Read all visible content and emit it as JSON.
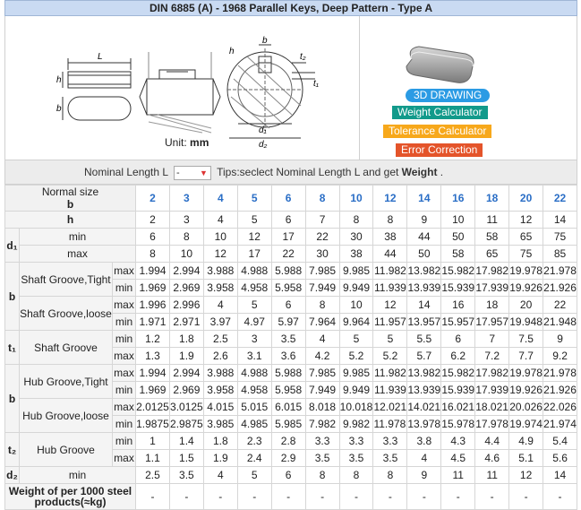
{
  "title": "DIN 6885 (A) - 1968 Parallel Keys, Deep Pattern - Type A",
  "unit_label": "Unit:",
  "unit_value": "mm",
  "diagram_labels": {
    "L": "L",
    "h": "h",
    "b": "b",
    "t1": "t₁",
    "t2": "t₂",
    "d1": "d₁",
    "d2": "d₂"
  },
  "buttons": {
    "drawing": "3D DRAWING",
    "weight": "Weight Calculator",
    "tolerance": "Tolerance Calculator",
    "error": "Error Correction"
  },
  "colors": {
    "header": "#c9daf2",
    "size_text": "#2a6ec6",
    "drawing_btn": "#2b9be4",
    "weight_btn": "#129a8b",
    "tolerance_btn": "#f7a81b",
    "error_btn": "#e4542a"
  },
  "filter": {
    "label": "Nominal Length L",
    "select_value": "-",
    "tips_prefix": "Tips:seclect Nominal Length L and get",
    "tips_bold": "Weight",
    "tips_suffix": "."
  },
  "table": {
    "normal_size_label": "Normal size",
    "normal_size_sub": "b",
    "sizes": [
      "2",
      "3",
      "4",
      "5",
      "6",
      "8",
      "10",
      "12",
      "14",
      "16",
      "18",
      "20",
      "22"
    ],
    "rows": [
      {
        "g": "",
        "label": "h",
        "sub": "",
        "vals": [
          "2",
          "3",
          "4",
          "5",
          "6",
          "7",
          "8",
          "8",
          "9",
          "10",
          "11",
          "12",
          "14"
        ]
      },
      {
        "g": "d1",
        "label": "min",
        "sub": "",
        "vals": [
          "6",
          "8",
          "10",
          "12",
          "17",
          "22",
          "30",
          "38",
          "44",
          "50",
          "58",
          "65",
          "75"
        ]
      },
      {
        "g": "",
        "label": "max",
        "sub": "",
        "vals": [
          "8",
          "10",
          "12",
          "17",
          "22",
          "30",
          "38",
          "44",
          "50",
          "58",
          "65",
          "75",
          "85"
        ]
      },
      {
        "g": "b",
        "label": "Shaft Groove,Tight",
        "sub": "max",
        "vals": [
          "1.994",
          "2.994",
          "3.988",
          "4.988",
          "5.988",
          "7.985",
          "9.985",
          "11.982",
          "13.982",
          "15.982",
          "17.982",
          "19.978",
          "21.978"
        ]
      },
      {
        "g": "",
        "label": "",
        "sub": "min",
        "vals": [
          "1.969",
          "2.969",
          "3.958",
          "4.958",
          "5.958",
          "7.949",
          "9.949",
          "11.939",
          "13.939",
          "15.939",
          "17.939",
          "19.926",
          "21.926"
        ]
      },
      {
        "g": "",
        "label": "Shaft Groove,loose",
        "sub": "max",
        "vals": [
          "1.996",
          "2.996",
          "4",
          "5",
          "6",
          "8",
          "10",
          "12",
          "14",
          "16",
          "18",
          "20",
          "22"
        ]
      },
      {
        "g": "",
        "label": "",
        "sub": "min",
        "vals": [
          "1.971",
          "2.971",
          "3.97",
          "4.97",
          "5.97",
          "7.964",
          "9.964",
          "11.957",
          "13.957",
          "15.957",
          "17.957",
          "19.948",
          "21.948"
        ]
      },
      {
        "g": "t1",
        "label": "Shaft Groove",
        "sub": "min",
        "vals": [
          "1.2",
          "1.8",
          "2.5",
          "3",
          "3.5",
          "4",
          "5",
          "5",
          "5.5",
          "6",
          "7",
          "7.5",
          "9"
        ]
      },
      {
        "g": "",
        "label": "",
        "sub": "max",
        "vals": [
          "1.3",
          "1.9",
          "2.6",
          "3.1",
          "3.6",
          "4.2",
          "5.2",
          "5.2",
          "5.7",
          "6.2",
          "7.2",
          "7.7",
          "9.2"
        ]
      },
      {
        "g": "b",
        "label": "Hub Groove,Tight",
        "sub": "max",
        "vals": [
          "1.994",
          "2.994",
          "3.988",
          "4.988",
          "5.988",
          "7.985",
          "9.985",
          "11.982",
          "13.982",
          "15.982",
          "17.982",
          "19.978",
          "21.978"
        ]
      },
      {
        "g": "",
        "label": "",
        "sub": "min",
        "vals": [
          "1.969",
          "2.969",
          "3.958",
          "4.958",
          "5.958",
          "7.949",
          "9.949",
          "11.939",
          "13.939",
          "15.939",
          "17.939",
          "19.926",
          "21.926"
        ]
      },
      {
        "g": "",
        "label": "Hub Groove,loose",
        "sub": "max",
        "vals": [
          "2.0125",
          "3.0125",
          "4.015",
          "5.015",
          "6.015",
          "8.018",
          "10.018",
          "12.0215",
          "14.0215",
          "16.0215",
          "18.0215",
          "20.026",
          "22.026"
        ]
      },
      {
        "g": "",
        "label": "",
        "sub": "min",
        "vals": [
          "1.9875",
          "2.9875",
          "3.985",
          "4.985",
          "5.985",
          "7.982",
          "9.982",
          "11.9785",
          "13.9785",
          "15.9785",
          "17.9785",
          "19.974",
          "21.974"
        ]
      },
      {
        "g": "t2",
        "label": "Hub Groove",
        "sub": "min",
        "vals": [
          "1",
          "1.4",
          "1.8",
          "2.3",
          "2.8",
          "3.3",
          "3.3",
          "3.3",
          "3.8",
          "4.3",
          "4.4",
          "4.9",
          "5.4"
        ]
      },
      {
        "g": "",
        "label": "",
        "sub": "max",
        "vals": [
          "1.1",
          "1.5",
          "1.9",
          "2.4",
          "2.9",
          "3.5",
          "3.5",
          "3.5",
          "4",
          "4.5",
          "4.6",
          "5.1",
          "5.6"
        ]
      },
      {
        "g": "d2",
        "label": "min",
        "sub": "",
        "vals": [
          "2.5",
          "3.5",
          "4",
          "5",
          "6",
          "8",
          "8",
          "8",
          "9",
          "11",
          "11",
          "12",
          "14"
        ]
      }
    ],
    "weight_label": "Weight of per 1000 steel products(≈kg)",
    "weight_vals": [
      "-",
      "-",
      "-",
      "-",
      "-",
      "-",
      "-",
      "-",
      "-",
      "-",
      "-",
      "-",
      "-"
    ],
    "group_labels": {
      "d1": "d₁",
      "b": "b",
      "t1": "t₁",
      "t2": "t₂",
      "d2": "d₂"
    }
  }
}
